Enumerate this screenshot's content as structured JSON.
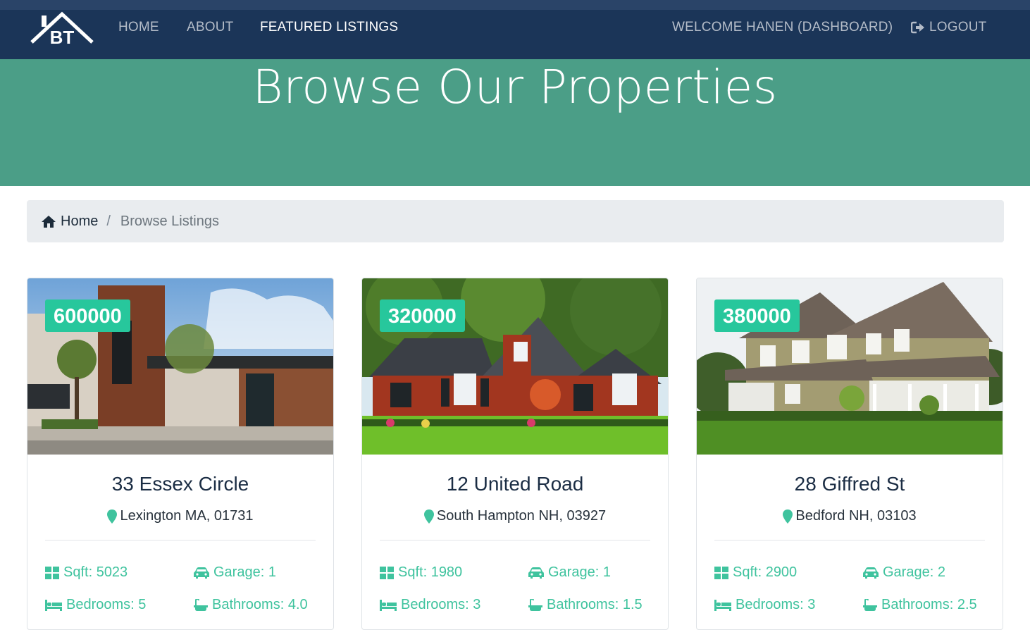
{
  "nav": {
    "links": [
      {
        "label": "HOME"
      },
      {
        "label": "ABOUT"
      },
      {
        "label": "FEATURED LISTINGS"
      }
    ],
    "welcome": "WELCOME HANEN (DASHBOARD)",
    "logout": "LOGOUT"
  },
  "hero": {
    "title": "Browse Our Properties"
  },
  "breadcrumb": {
    "home": "Home",
    "separator": "/",
    "current": "Browse Listings"
  },
  "listings": [
    {
      "price": "600000",
      "title": "33 Essex Circle",
      "address": "Lexington MA, 01731",
      "sqft": "Sqft: 5023",
      "garage": "Garage: 1",
      "bedrooms": "Bedrooms: 5",
      "bathrooms": "Bathrooms: 4.0"
    },
    {
      "price": "320000",
      "title": "12 United Road",
      "address": "South Hampton NH, 03927",
      "sqft": "Sqft: 1980",
      "garage": "Garage: 1",
      "bedrooms": "Bedrooms: 3",
      "bathrooms": "Bathrooms: 1.5"
    },
    {
      "price": "380000",
      "title": "28 Giffred St",
      "address": "Bedford NH, 03103",
      "sqft": "Sqft: 2900",
      "garage": "Garage: 2",
      "bedrooms": "Bedrooms: 3",
      "bathrooms": "Bathrooms: 2.5"
    }
  ],
  "colors": {
    "navbar": "#1b3558",
    "hero": "#4b9e87",
    "accent": "#27c79c",
    "feature_text": "#3fc39e"
  },
  "icons": {
    "logo": "house-bt-logo",
    "logout": "sign-out-icon",
    "breadcrumb_home": "home-icon",
    "address": "map-marker-icon",
    "sqft": "th-large-icon",
    "garage": "car-icon",
    "bedrooms": "bed-icon",
    "bathrooms": "bath-icon"
  }
}
